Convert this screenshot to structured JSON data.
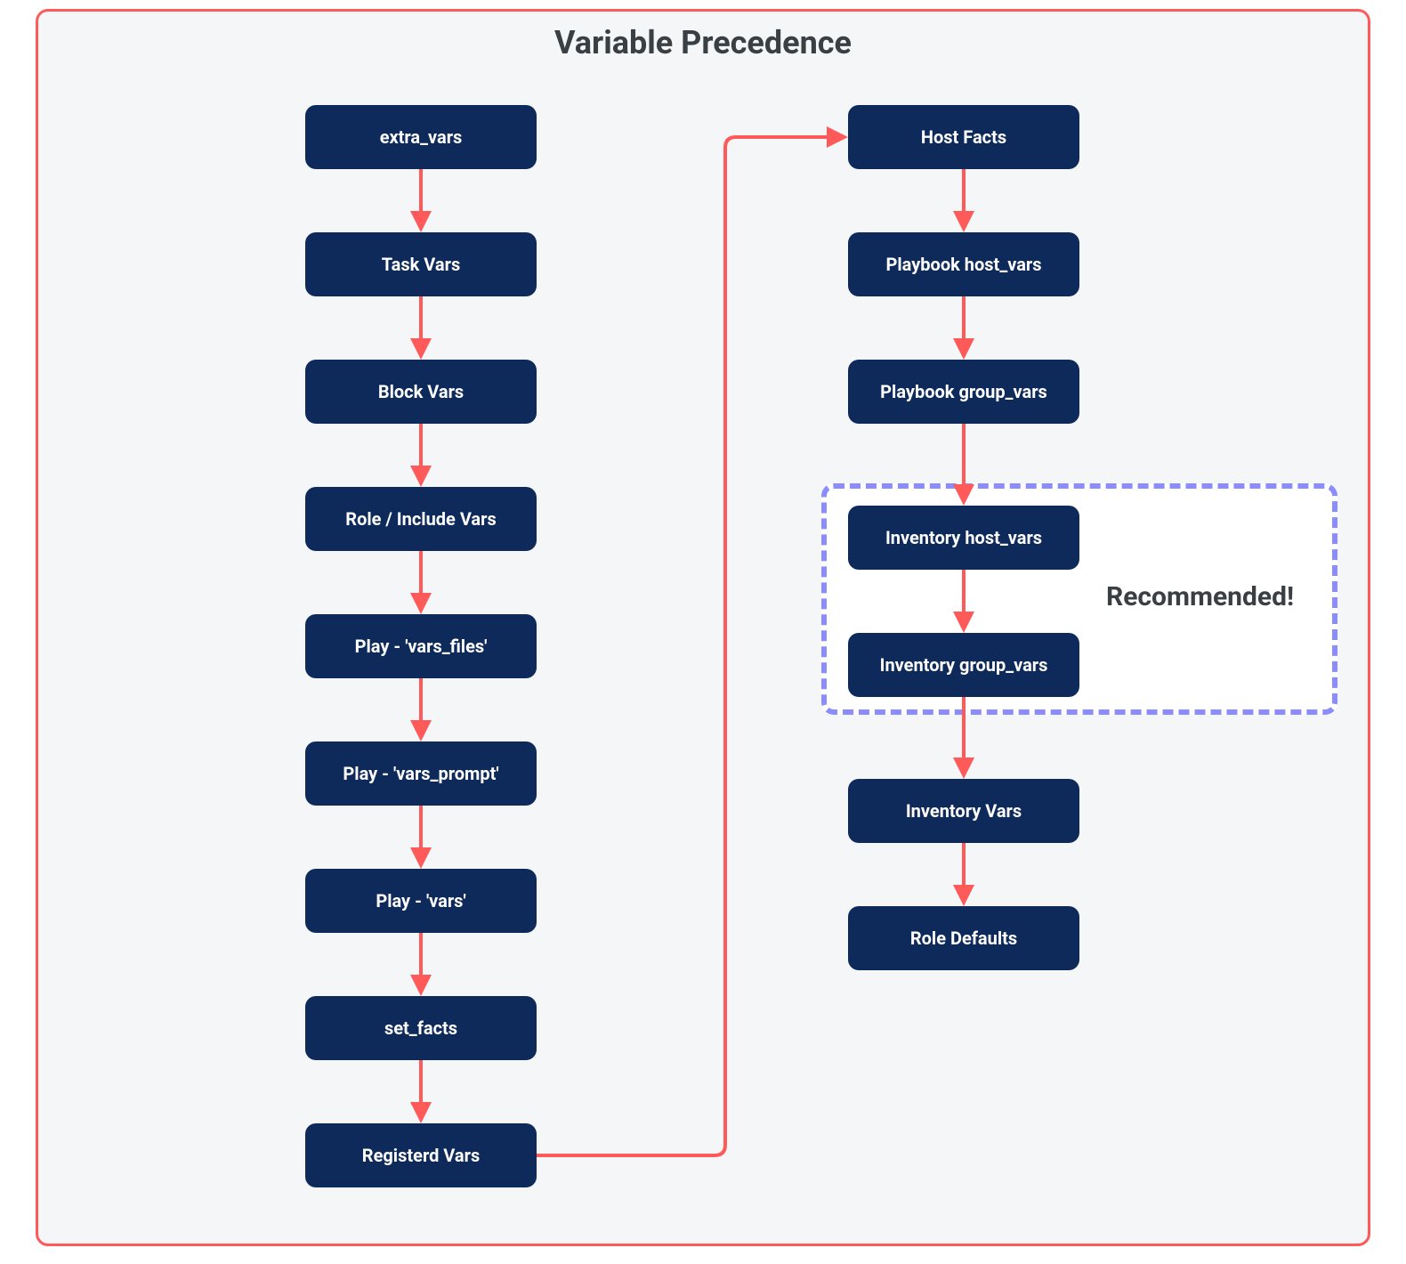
{
  "title": "Variable Precedence",
  "recommended_label": "Recommended!",
  "left_column": [
    "extra_vars",
    "Task Vars",
    "Block Vars",
    "Role / Include Vars",
    "Play - 'vars_files'",
    "Play - 'vars_prompt'",
    "Play - 'vars'",
    "set_facts",
    "Registerd Vars"
  ],
  "right_column": [
    "Host Facts",
    "Playbook host_vars",
    "Playbook group_vars",
    "Inventory host_vars",
    "Inventory group_vars",
    "Inventory Vars",
    "Role Defaults"
  ],
  "colors": {
    "node_bg": "#0d2a5b",
    "node_text": "#ffffff",
    "border": "#ff5a5a",
    "arrow": "#ff5a5a",
    "recommended_border": "#8a8cff",
    "container_bg": "#f4f6f8",
    "title_text": "#3a3f44"
  }
}
